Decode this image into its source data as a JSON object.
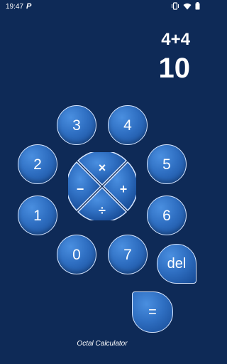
{
  "status_bar": {
    "time": "19:47",
    "app_icon_letter": "P",
    "icons": [
      "vibrate-icon",
      "wifi-icon",
      "battery-icon"
    ]
  },
  "display": {
    "expression": "4+4",
    "result": "10"
  },
  "digits": {
    "d0": "0",
    "d1": "1",
    "d2": "2",
    "d3": "3",
    "d4": "4",
    "d5": "5",
    "d6": "6",
    "d7": "7"
  },
  "operators": {
    "multiply": "×",
    "add": "+",
    "subtract": "−",
    "divide": "÷"
  },
  "actions": {
    "delete": "del",
    "equals": "="
  },
  "footer": {
    "title": "Octal Calculator"
  },
  "colors": {
    "background": "#0e2a57",
    "key_fill": "#2f6fc2",
    "key_border": "#d7e6ff"
  }
}
